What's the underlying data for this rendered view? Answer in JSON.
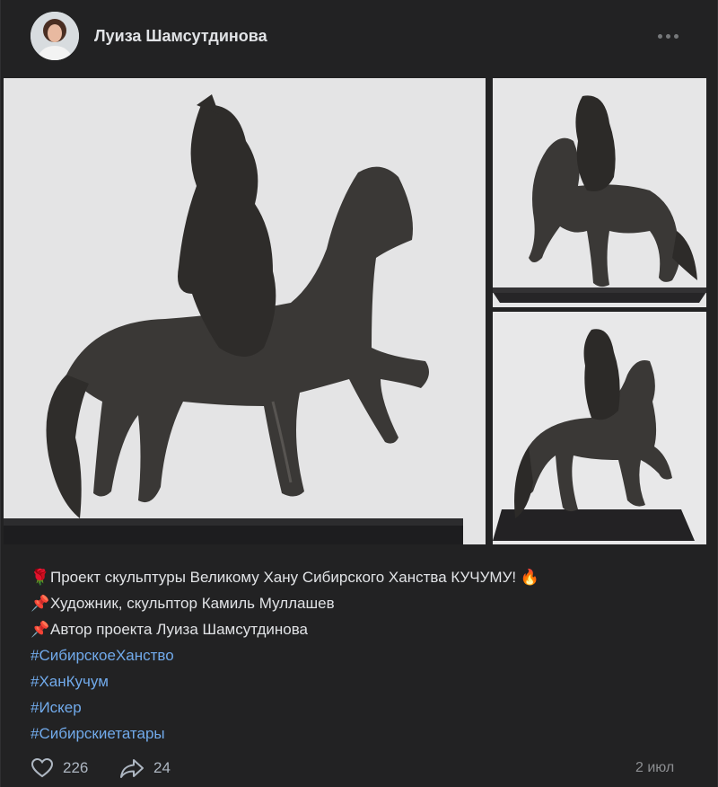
{
  "post": {
    "author": "Луиза Шамсутдинова",
    "lines": [
      {
        "emoji": "🌹",
        "text": "Проект скульптуры Великому Хану Сибирского Ханства КУЧУМУ!",
        "trail": "🔥"
      },
      {
        "emoji": "📌",
        "text": "Художник, скульптор Камиль Муллашев"
      },
      {
        "emoji": "📌",
        "text": "Автор проекта Луиза Шамсутдинова"
      }
    ],
    "hashtags": [
      "#СибирскоеХанство",
      "#ХанКучум",
      "#Искер",
      "#Сибирскиетатары"
    ],
    "likes": "226",
    "shares": "24",
    "date": "2 июл"
  },
  "icons": {
    "more": "more-horizontal-icon",
    "like": "heart-icon",
    "share": "share-arrow-icon"
  },
  "colors": {
    "background": "#222223",
    "hashtag": "#71aaeb",
    "text": "#e1e3e6",
    "muted": "#8c8e91"
  }
}
